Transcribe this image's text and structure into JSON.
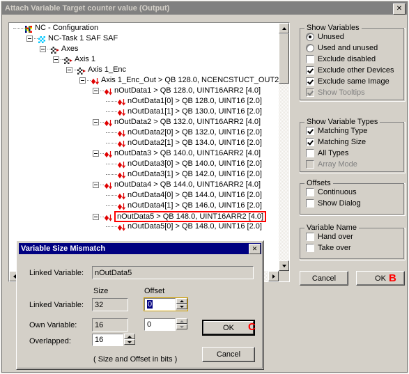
{
  "window": {
    "title": "Attach Variable Target counter value (Output)",
    "close_label": "✕"
  },
  "tree": {
    "items": [
      {
        "depth": 0,
        "label": "NC - Configuration",
        "addr": "",
        "expander": false,
        "icon": "nc-config-icon"
      },
      {
        "depth": 1,
        "label": "NC-Task 1 SAF SAF",
        "addr": "",
        "expander": true,
        "icon": "nc-task-icon"
      },
      {
        "depth": 2,
        "label": "Axes",
        "addr": "",
        "expander": true,
        "icon": "axes-icon"
      },
      {
        "depth": 3,
        "label": "Axis 1",
        "addr": "",
        "expander": true,
        "icon": "axis-icon"
      },
      {
        "depth": 4,
        "label": "Axis 1_Enc",
        "addr": "",
        "expander": true,
        "icon": "encoder-icon"
      },
      {
        "depth": 5,
        "label": "Axis 1_Enc_Out",
        "addr": "QB 128.0, NCENCSTUCT_OUT2",
        "expander": true,
        "icon": "output-var-icon"
      },
      {
        "depth": 6,
        "label": "nOutData1",
        "addr": "QB 128.0, UINT16ARR2 [4.0]",
        "expander": true,
        "icon": "output-var-icon"
      },
      {
        "depth": 7,
        "label": "nOutData1[0]",
        "addr": "QB 128.0, UINT16 [2.0]",
        "expander": false,
        "icon": "output-var-icon"
      },
      {
        "depth": 7,
        "label": "nOutData1[1]",
        "addr": "QB 130.0, UINT16 [2.0]",
        "expander": false,
        "icon": "output-var-icon"
      },
      {
        "depth": 6,
        "label": "nOutData2",
        "addr": "QB 132.0, UINT16ARR2 [4.0]",
        "expander": true,
        "icon": "output-var-icon"
      },
      {
        "depth": 7,
        "label": "nOutData2[0]",
        "addr": "QB 132.0, UINT16 [2.0]",
        "expander": false,
        "icon": "output-var-icon"
      },
      {
        "depth": 7,
        "label": "nOutData2[1]",
        "addr": "QB 134.0, UINT16 [2.0]",
        "expander": false,
        "icon": "output-var-icon"
      },
      {
        "depth": 6,
        "label": "nOutData3",
        "addr": "QB 140.0, UINT16ARR2 [4.0]",
        "expander": true,
        "icon": "output-var-icon"
      },
      {
        "depth": 7,
        "label": "nOutData3[0]",
        "addr": "QB 140.0, UINT16 [2.0]",
        "expander": false,
        "icon": "output-var-icon"
      },
      {
        "depth": 7,
        "label": "nOutData3[1]",
        "addr": "QB 142.0, UINT16 [2.0]",
        "expander": false,
        "icon": "output-var-icon"
      },
      {
        "depth": 6,
        "label": "nOutData4",
        "addr": "QB 144.0, UINT16ARR2 [4.0]",
        "expander": true,
        "icon": "output-var-icon"
      },
      {
        "depth": 7,
        "label": "nOutData4[0]",
        "addr": "QB 144.0, UINT16 [2.0]",
        "expander": false,
        "icon": "output-var-icon"
      },
      {
        "depth": 7,
        "label": "nOutData4[1]",
        "addr": "QB 146.0, UINT16 [2.0]",
        "expander": false,
        "icon": "output-var-icon"
      },
      {
        "depth": 6,
        "label": "nOutData5",
        "addr": "QB 148.0, UINT16ARR2 [4.0]",
        "expander": true,
        "icon": "output-var-icon",
        "highlighted": true
      },
      {
        "depth": 7,
        "label": "nOutData5[0]",
        "addr": "QB 148.0, UINT16 [2.0]",
        "expander": false,
        "icon": "output-var-icon"
      }
    ],
    "separator": ">"
  },
  "panel": {
    "show_variables": {
      "title": "Show Variables",
      "options": [
        {
          "label": "Unused",
          "type": "radio",
          "checked": true,
          "disabled": false
        },
        {
          "label": "Used and unused",
          "type": "radio",
          "checked": false,
          "disabled": false
        },
        {
          "label": "Exclude disabled",
          "type": "check",
          "checked": false,
          "disabled": false
        },
        {
          "label": "Exclude other Devices",
          "type": "check",
          "checked": true,
          "disabled": false
        },
        {
          "label": "Exclude same Image",
          "type": "check",
          "checked": true,
          "disabled": false
        },
        {
          "label": "Show Tooltips",
          "type": "check",
          "checked": true,
          "disabled": true
        }
      ]
    },
    "show_variable_types": {
      "title": "Show Variable Types",
      "options": [
        {
          "label": "Matching Type",
          "type": "check",
          "checked": true,
          "disabled": false
        },
        {
          "label": "Matching Size",
          "type": "check",
          "checked": true,
          "disabled": false
        },
        {
          "label": "All Types",
          "type": "check",
          "checked": false,
          "disabled": false
        },
        {
          "label": "Array Mode",
          "type": "check",
          "checked": false,
          "disabled": true
        }
      ]
    },
    "offsets": {
      "title": "Offsets",
      "options": [
        {
          "label": "Continuous",
          "type": "check",
          "checked": false,
          "disabled": false
        },
        {
          "label": "Show Dialog",
          "type": "check",
          "checked": false,
          "disabled": false
        }
      ]
    },
    "variable_name": {
      "title": "Variable Name",
      "options": [
        {
          "label": "Hand over",
          "type": "check",
          "checked": false,
          "disabled": false
        },
        {
          "label": "Take over",
          "type": "check",
          "checked": false,
          "disabled": false
        }
      ]
    },
    "buttons": {
      "cancel": "Cancel",
      "ok": "OK",
      "ok_annotation": "B"
    }
  },
  "dialog": {
    "title": "Variable Size Mismatch",
    "close_label": "✕",
    "linked_variable_label": "Linked Variable:",
    "linked_variable_value": "nOutData5",
    "col_size": "Size",
    "col_offset": "Offset",
    "rows": [
      {
        "label": "Linked Variable:",
        "size": "32",
        "offset": "0",
        "offset_selected": true,
        "offset_disabled": false
      },
      {
        "label": "Own Variable:",
        "size": "16",
        "offset": "0",
        "offset_selected": false,
        "offset_disabled": true
      }
    ],
    "overlapped_label": "Overlapped:",
    "overlapped_value": "16",
    "note": "( Size and Offset in bits )",
    "buttons": {
      "ok": "OK",
      "ok_annotation": "C",
      "cancel": "Cancel"
    }
  },
  "colors": {
    "face": "#d4d0c8",
    "title_inactive": "#808080",
    "title_active": "#000080",
    "highlight_red": "#ff0000"
  }
}
